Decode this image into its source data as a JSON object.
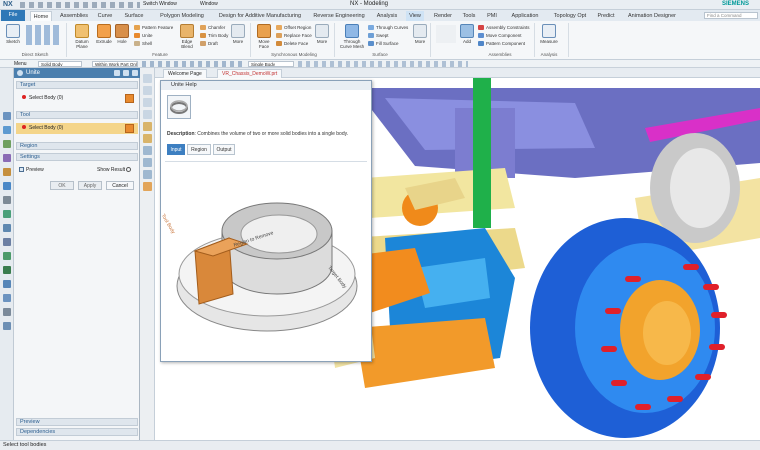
{
  "titlebar": {
    "logo": "NX",
    "quick_switch": "Switch Window",
    "window_menu": "Window",
    "title": "NX - Modeling",
    "brand": "SIEMENS",
    "search_placeholder": "Find a Command"
  },
  "tabs": [
    "File",
    "Home",
    "Assemblies",
    "Curve",
    "Surface",
    "Polygon Modeling",
    "Design for Additive Manufacturing",
    "Reverse Engineering",
    "Analysis",
    "View",
    "Render",
    "Tools",
    "PMI",
    "Application",
    "Topology Opt",
    "Predict",
    "Animation Designer"
  ],
  "active_tab": "Home",
  "highlighted_tab": "View",
  "ribbon": {
    "sketch": "Sketch",
    "direct_sketch": "Direct Sketch",
    "datum_plane": "Datum Plane",
    "extrude": "Extrude",
    "hole": "Hole",
    "pattern_feature": "Pattern Feature",
    "unite": "Unite",
    "shell": "Shell",
    "edge_blend": "Edge Blend",
    "chamfer": "Chamfer",
    "trim_body": "Trim Body",
    "draft": "Draft",
    "feature_group": "Feature",
    "more": "More",
    "move_face": "Move Face",
    "offset_region": "Offset Region",
    "replace_face": "Replace Face",
    "delete_face": "Delete Face",
    "sync_group": "Synchronous Modeling",
    "through_curve_mesh": "Through Curve Mesh",
    "through_curves": "Through Curves",
    "swept": "Swept",
    "fill_surface": "Fill Surface",
    "surface_group": "Surface",
    "add": "Add",
    "assembly_constraints": "Assembly Constraints",
    "move_component": "Move Component",
    "pattern_component": "Pattern Component",
    "assemblies_group": "Assemblies",
    "measure": "Measure",
    "analysis_group": "Analysis"
  },
  "toolbar2": {
    "menu": "Menu",
    "filter": "Solid Body",
    "scope": "Within Work Part Only",
    "select": "Single Body"
  },
  "panel": {
    "title": "Unite",
    "target_section": "Target",
    "target_row": "Select Body (0)",
    "tool_section": "Tool",
    "tool_row": "Select Body (0)",
    "region_section": "Region",
    "settings_section": "Settings",
    "preview_label": "Preview",
    "show_result_label": "Show Result",
    "ok": "OK",
    "apply": "Apply",
    "cancel": "Cancel",
    "preview_section": "Preview",
    "dependencies_section": "Dependencies"
  },
  "viewport_tabs": [
    "Welcome Page",
    "VR_Chassis_DemoW.prt"
  ],
  "help": {
    "title": "Unite Help",
    "description_label": "Description",
    "description": ": Combines the volume of two or more solid bodies into a single body.",
    "tabs": [
      "Input",
      "Region",
      "Output"
    ],
    "active_tab": "Input",
    "labels": {
      "tool": "Tool Body",
      "region": "Region to Remove",
      "target": "Target Body"
    }
  },
  "status": "Select tool bodies"
}
